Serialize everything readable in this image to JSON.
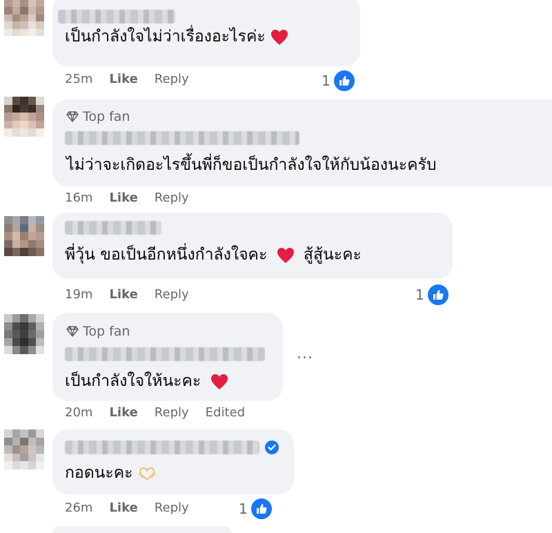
{
  "comments": [
    {
      "text": "เป็นกำลังใจไม่ว่าเรื่องอะไรค่ะ",
      "time": "25m",
      "like": "Like",
      "reply": "Reply",
      "reaction_count": "1",
      "reaction_icon": "like-icon",
      "has_heart": true
    },
    {
      "badge": "Top fan",
      "text": "ไม่ว่าจะเกิดอะไรขึ้นพี่ก็ขอเป็นกำลังใจให้กับน้องนะครับ",
      "time": "16m",
      "like": "Like",
      "reply": "Reply"
    },
    {
      "text": "พี่วุ้น ขอเป็นอีกหนึ่งกำลังใจคะ",
      "text_after": "สู้สู้นะคะ",
      "time": "19m",
      "like": "Like",
      "reply": "Reply",
      "reaction_count": "1",
      "reaction_icon": "like-icon",
      "has_heart": true
    },
    {
      "badge": "Top fan",
      "text": "เป็นกำลังใจให้นะคะ",
      "time": "20m",
      "like": "Like",
      "reply": "Reply",
      "edited": "Edited",
      "more_menu": "...",
      "has_heart": true
    },
    {
      "text": "กอดนะคะ",
      "time": "26m",
      "like": "Like",
      "reply": "Reply",
      "reaction_count": "1",
      "reaction_icon": "like-icon",
      "verified": true
    }
  ],
  "colors": {
    "bubble": "#f0f2f5",
    "meta_text": "#65676b",
    "like_blue": "#1877f2",
    "heart_red": "#e41e3f"
  }
}
